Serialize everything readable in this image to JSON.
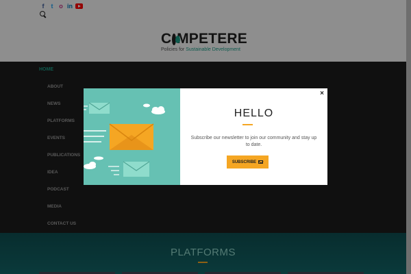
{
  "header": {
    "social_icons": [
      "facebook-icon",
      "twitter-icon",
      "instagram-icon",
      "linkedin-icon",
      "youtube-icon"
    ],
    "social_glyphs": {
      "facebook": "f",
      "twitter": "t",
      "instagram": "o",
      "linkedin": "in"
    },
    "logo": {
      "pre": "C",
      "post": "MPETERE",
      "tagline_prefix": "Policies for ",
      "tagline_highlight": "Sustainable Development"
    }
  },
  "nav": {
    "home": "HOME",
    "items": [
      "ABOUT",
      "NEWS",
      "PLATFORMS",
      "EVENTS",
      "PUBLICATIONS",
      "IDEA",
      "PODCAST",
      "MEDIA",
      "CONTACT US"
    ]
  },
  "section": {
    "title": "PLATFORMS"
  },
  "modal": {
    "close_glyph": "×",
    "title": "HELLO",
    "description": "Subscribe our newsletter to join our community and stay up to date.",
    "button_label": "SUBSCRIBE"
  },
  "colors": {
    "accent": "#f5a623",
    "brand_teal": "#1b9b86",
    "art_bg": "#66c1b3"
  }
}
